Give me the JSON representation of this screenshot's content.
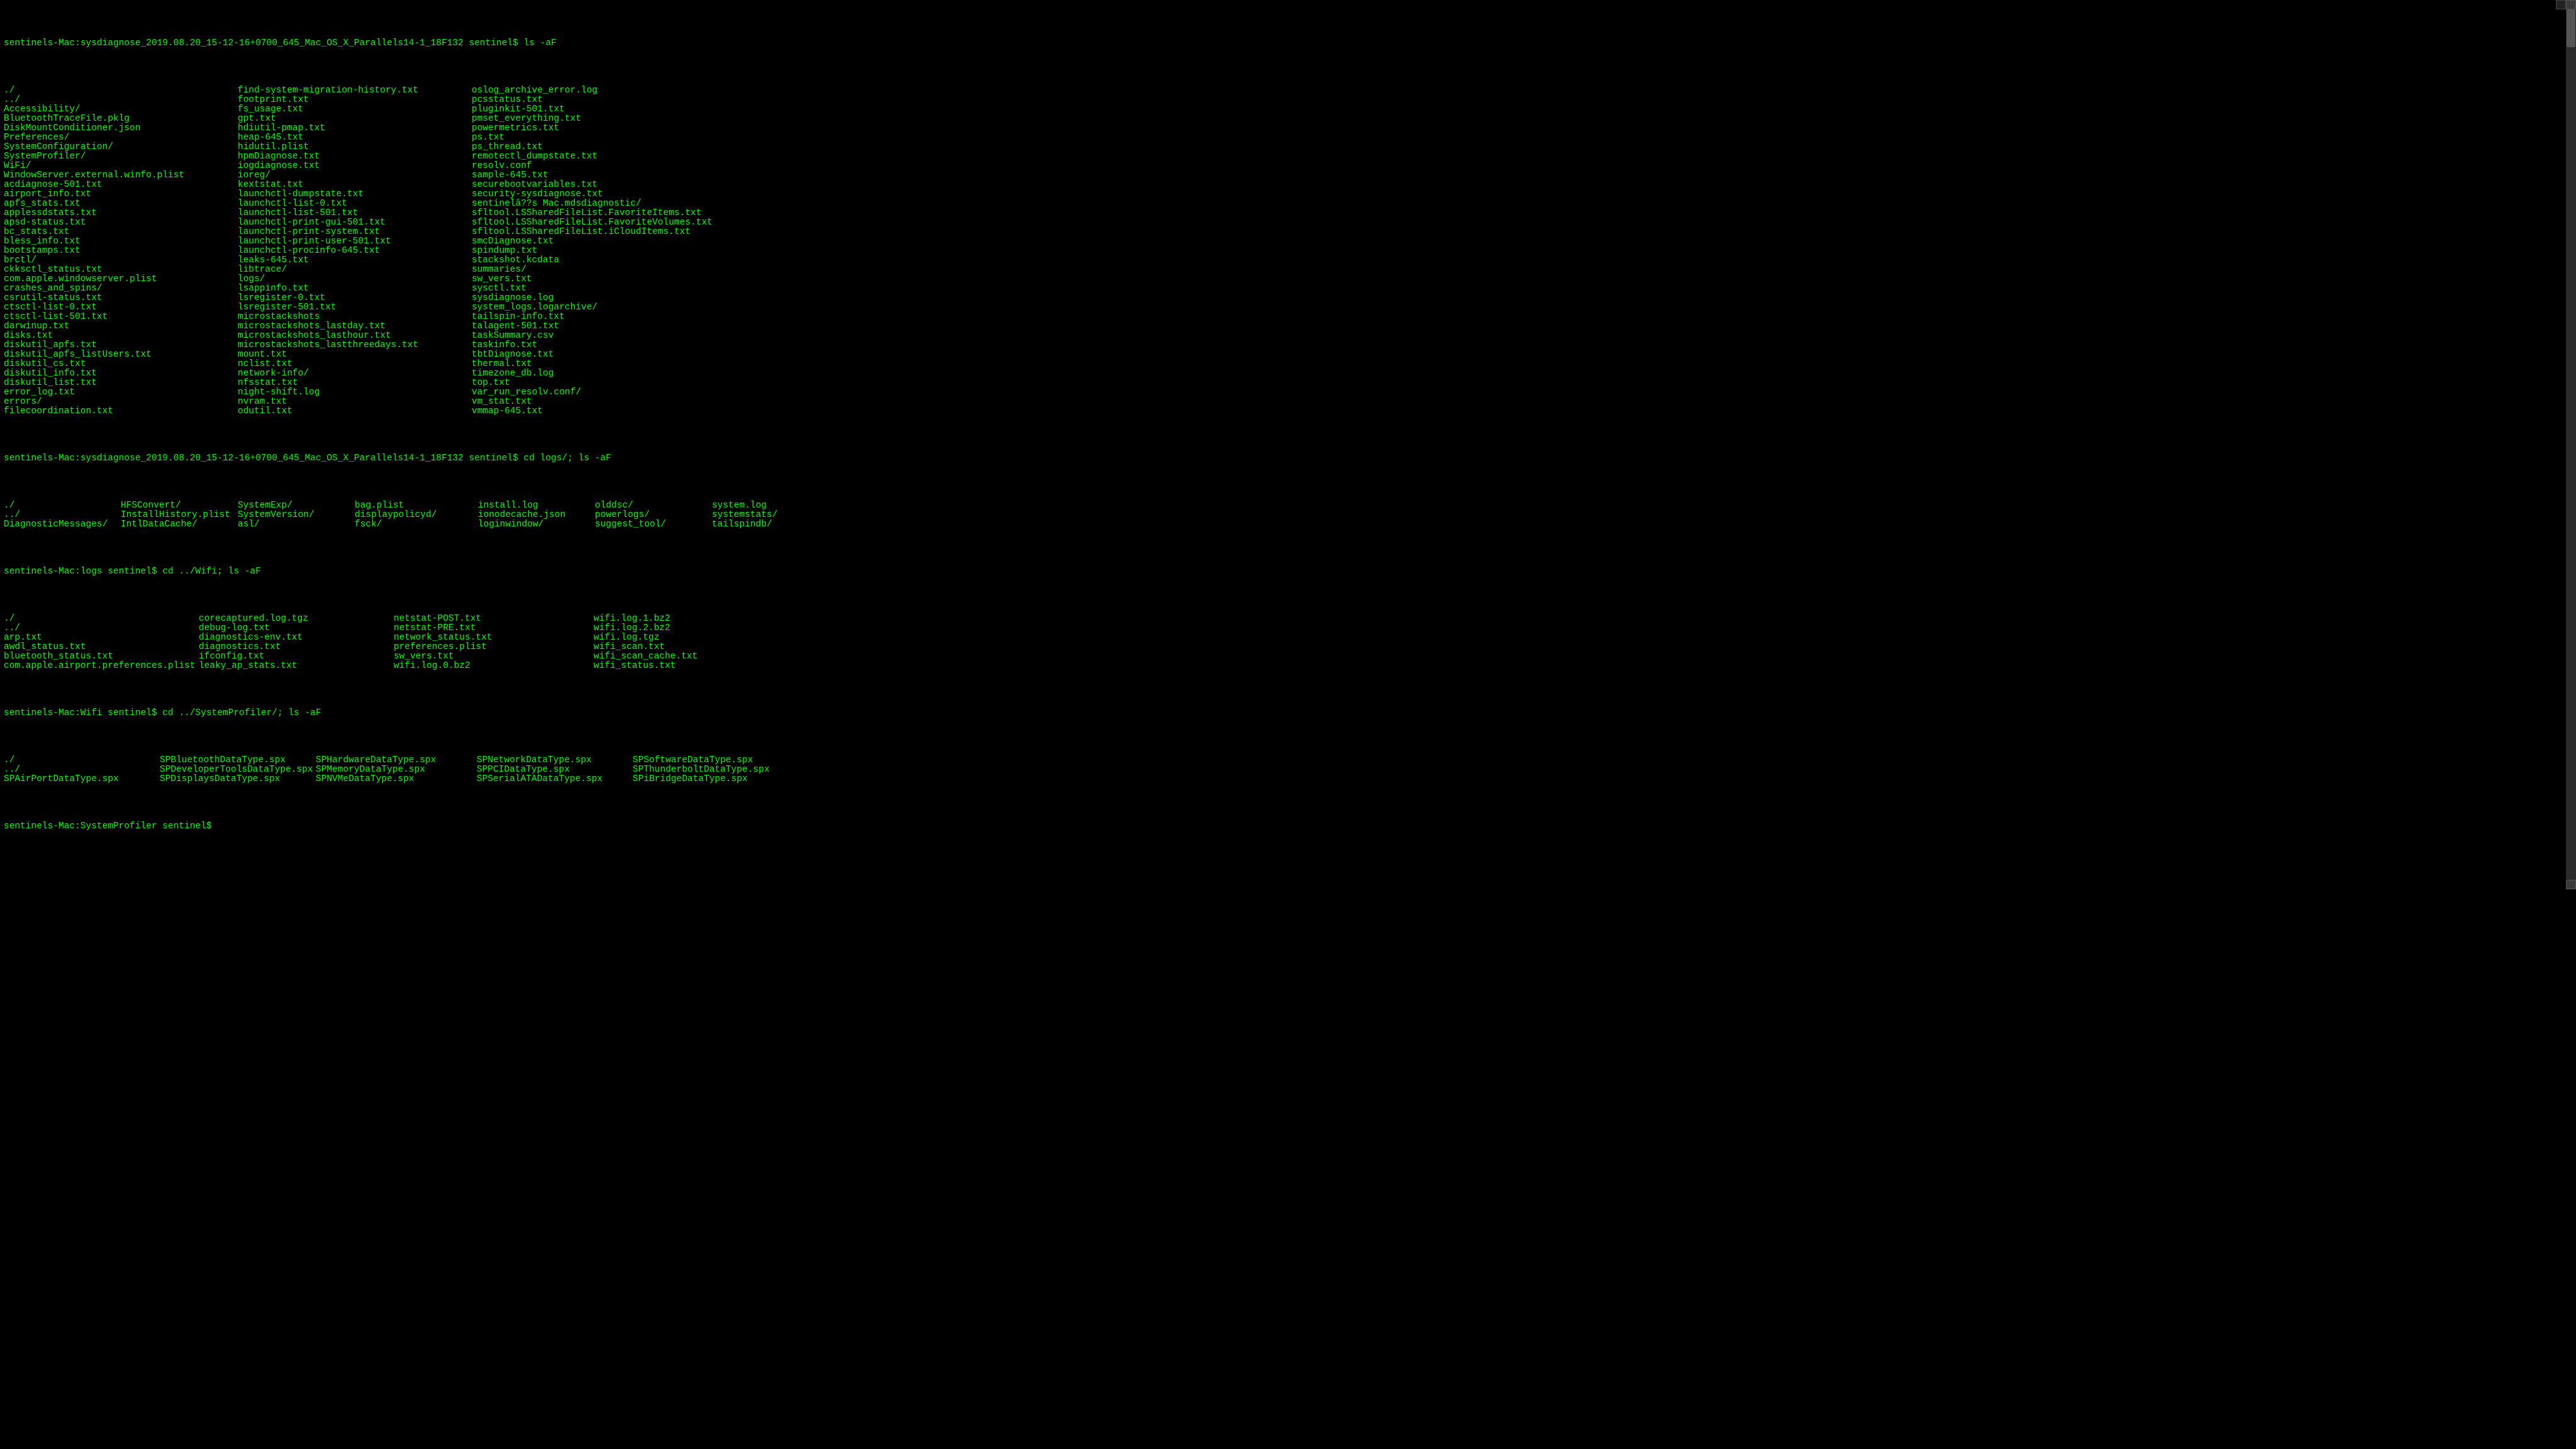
{
  "prompts": {
    "p1": "sentinels-Mac:sysdiagnose_2019.08.20_15-12-16+0700_645_Mac_OS_X_Parallels14-1_18F132 sentinel$ ",
    "c1": "ls -aF",
    "p2": "sentinels-Mac:sysdiagnose_2019.08.20_15-12-16+0700_645_Mac_OS_X_Parallels14-1_18F132 sentinel$ ",
    "c2": "cd logs/; ls -aF",
    "p3": "sentinels-Mac:logs sentinel$ ",
    "c3": "cd ../Wifi; ls -aF",
    "p4": "sentinels-Mac:Wifi sentinel$ ",
    "c4": "cd ../SystemProfiler/; ls -aF",
    "p5": "sentinels-Mac:SystemProfiler sentinel$ "
  },
  "ls1": {
    "col1": [
      "./",
      "../",
      "Accessibility/",
      "BluetoothTraceFile.pklg",
      "DiskMountConditioner.json",
      "Preferences/",
      "SystemConfiguration/",
      "SystemProfiler/",
      "WiFi/",
      "WindowServer.external.winfo.plist",
      "acdiagnose-501.txt",
      "airport_info.txt",
      "apfs_stats.txt",
      "applessdstats.txt",
      "apsd-status.txt",
      "bc_stats.txt",
      "bless_info.txt",
      "bootstamps.txt",
      "brctl/",
      "ckksctl_status.txt",
      "com.apple.windowserver.plist",
      "crashes_and_spins/",
      "csrutil-status.txt",
      "ctsctl-list-0.txt",
      "ctsctl-list-501.txt",
      "darwinup.txt",
      "disks.txt",
      "diskutil_apfs.txt",
      "diskutil_apfs_listUsers.txt",
      "diskutil_cs.txt",
      "diskutil_info.txt",
      "diskutil_list.txt",
      "error_log.txt",
      "errors/",
      "filecoordination.txt"
    ],
    "col2": [
      "find-system-migration-history.txt",
      "footprint.txt",
      "fs_usage.txt",
      "gpt.txt",
      "hdiutil-pmap.txt",
      "heap-645.txt",
      "hidutil.plist",
      "hpmDiagnose.txt",
      "iogdiagnose.txt",
      "ioreg/",
      "kextstat.txt",
      "launchctl-dumpstate.txt",
      "launchctl-list-0.txt",
      "launchctl-list-501.txt",
      "launchctl-print-gui-501.txt",
      "launchctl-print-system.txt",
      "launchctl-print-user-501.txt",
      "launchctl-procinfo-645.txt",
      "leaks-645.txt",
      "libtrace/",
      "logs/",
      "lsappinfo.txt",
      "lsregister-0.txt",
      "lsregister-501.txt",
      "microstackshots",
      "microstackshots_lastday.txt",
      "microstackshots_lasthour.txt",
      "microstackshots_lastthreedays.txt",
      "mount.txt",
      "nclist.txt",
      "network-info/",
      "nfsstat.txt",
      "night-shift.log",
      "nvram.txt",
      "odutil.txt"
    ],
    "col3": [
      "oslog_archive_error.log",
      "pcsstatus.txt",
      "pluginkit-501.txt",
      "pmset_everything.txt",
      "powermetrics.txt",
      "ps.txt",
      "ps_thread.txt",
      "remotectl_dumpstate.txt",
      "resolv.conf",
      "sample-645.txt",
      "securebootvariables.txt",
      "security-sysdiagnose.txt",
      "sentinelâ??s Mac.mdsdiagnostic/",
      "sfltool.LSSharedFileList.FavoriteItems.txt",
      "sfltool.LSSharedFileList.FavoriteVolumes.txt",
      "sfltool.LSSharedFileList.iCloudItems.txt",
      "smcDiagnose.txt",
      "spindump.txt",
      "stackshot.kcdata",
      "summaries/",
      "sw_vers.txt",
      "sysctl.txt",
      "sysdiagnose.log",
      "system_logs.logarchive/",
      "tailspin-info.txt",
      "talagent-501.txt",
      "taskSummary.csv",
      "taskinfo.txt",
      "tbtDiagnose.txt",
      "thermal.txt",
      "timezone_db.log",
      "top.txt",
      "var_run_resolv.conf/",
      "vm_stat.txt",
      "vmmap-645.txt"
    ]
  },
  "ls2": {
    "col1": [
      "./",
      "../",
      "DiagnosticMessages/"
    ],
    "col2": [
      "HFSConvert/",
      "InstallHistory.plist",
      "IntlDataCache/"
    ],
    "col3": [
      "SystemExp/",
      "SystemVersion/",
      "asl/"
    ],
    "col4": [
      "bag.plist",
      "displaypolicyd/",
      "fsck/"
    ],
    "col5": [
      "install.log",
      "ionodecache.json",
      "loginwindow/"
    ],
    "col6": [
      "olddsc/",
      "powerlogs/",
      "suggest_tool/"
    ],
    "col7": [
      "system.log",
      "systemstats/",
      "tailspindb/"
    ]
  },
  "ls3": {
    "col1": [
      "./",
      "../",
      "arp.txt",
      "awdl_status.txt",
      "bluetooth_status.txt",
      "com.apple.airport.preferences.plist"
    ],
    "col2": [
      "corecaptured.log.tgz",
      "debug-log.txt",
      "diagnostics-env.txt",
      "diagnostics.txt",
      "ifconfig.txt",
      "leaky_ap_stats.txt"
    ],
    "col3": [
      "netstat-POST.txt",
      "netstat-PRE.txt",
      "network_status.txt",
      "preferences.plist",
      "sw_vers.txt",
      "wifi.log.0.bz2"
    ],
    "col4": [
      "wifi.log.1.bz2",
      "wifi.log.2.bz2",
      "wifi.log.tgz",
      "wifi_scan.txt",
      "wifi_scan_cache.txt",
      "wifi_status.txt"
    ]
  },
  "ls4": {
    "col1": [
      "./",
      "../",
      "SPAirPortDataType.spx"
    ],
    "col2": [
      "SPBluetoothDataType.spx",
      "SPDeveloperToolsDataType.spx",
      "SPDisplaysDataType.spx"
    ],
    "col3": [
      "SPHardwareDataType.spx",
      "SPMemoryDataType.spx",
      "SPNVMeDataType.spx"
    ],
    "col4": [
      "SPNetworkDataType.spx",
      "SPPCIDataType.spx",
      "SPSerialATADataType.spx"
    ],
    "col5": [
      "SPSoftwareDataType.spx",
      "SPThunderboltDataType.spx",
      "SPiBridgeDataType.spx"
    ]
  }
}
